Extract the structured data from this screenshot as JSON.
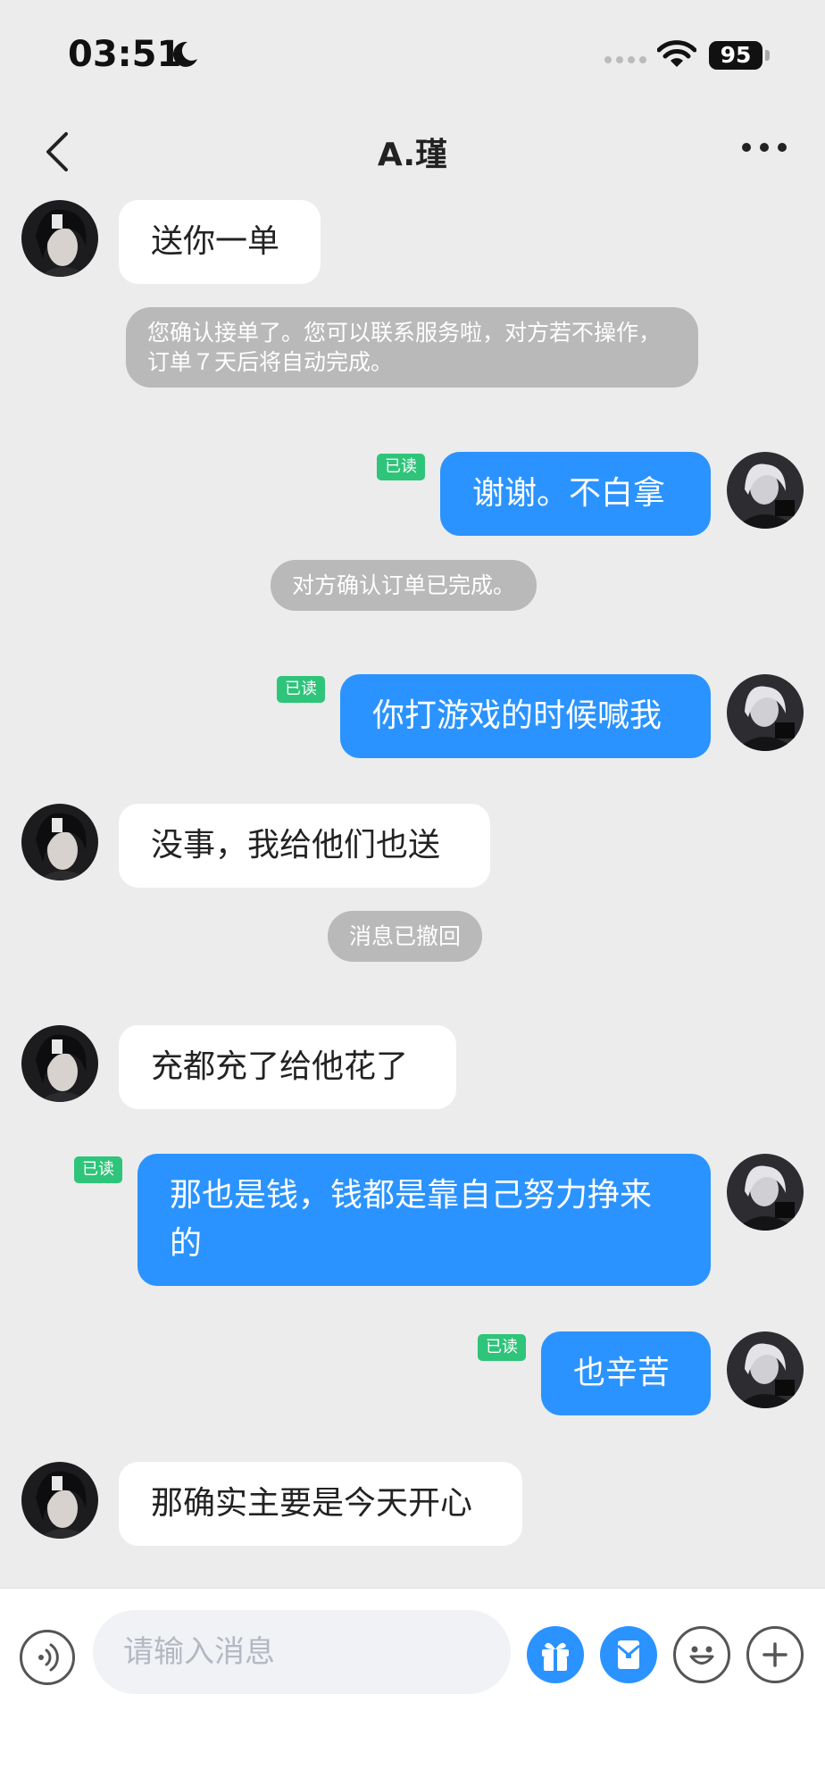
{
  "status_bar": {
    "time": "03:51",
    "battery": "95"
  },
  "header": {
    "title": "A.瑾"
  },
  "messages": {
    "m1": {
      "text": "送你一单"
    },
    "sys1": {
      "text": "您确认接单了。您可以联系服务啦，对方若不操作，订单７天后将自动完成。"
    },
    "m2": {
      "text": "谢谢。不白拿",
      "read": "已读"
    },
    "sys2": {
      "text": "对方确认订单已完成。"
    },
    "m3": {
      "text": "你打游戏的时候喊我",
      "read": "已读"
    },
    "m4": {
      "text": "没事，我给他们也送"
    },
    "sys3": {
      "text": "消息已撤回"
    },
    "m5": {
      "text": "充都充了给他花了"
    },
    "m6": {
      "text": "那也是钱，钱都是靠自己努力挣来的",
      "read": "已读"
    },
    "m7": {
      "text": "也辛苦",
      "read": "已读"
    },
    "m8": {
      "text": "那确实主要是今天开心"
    }
  },
  "input_bar": {
    "placeholder": "请输入消息"
  },
  "colors": {
    "outgoing_bubble": "#2a93ff",
    "read_badge": "#2ec47a",
    "system_notice": "#b9b9b9"
  },
  "icons": [
    "moon-icon",
    "wifi-icon",
    "back-icon",
    "more-icon",
    "voice-icon",
    "gift-icon",
    "red-packet-icon",
    "emoji-icon",
    "plus-icon"
  ]
}
